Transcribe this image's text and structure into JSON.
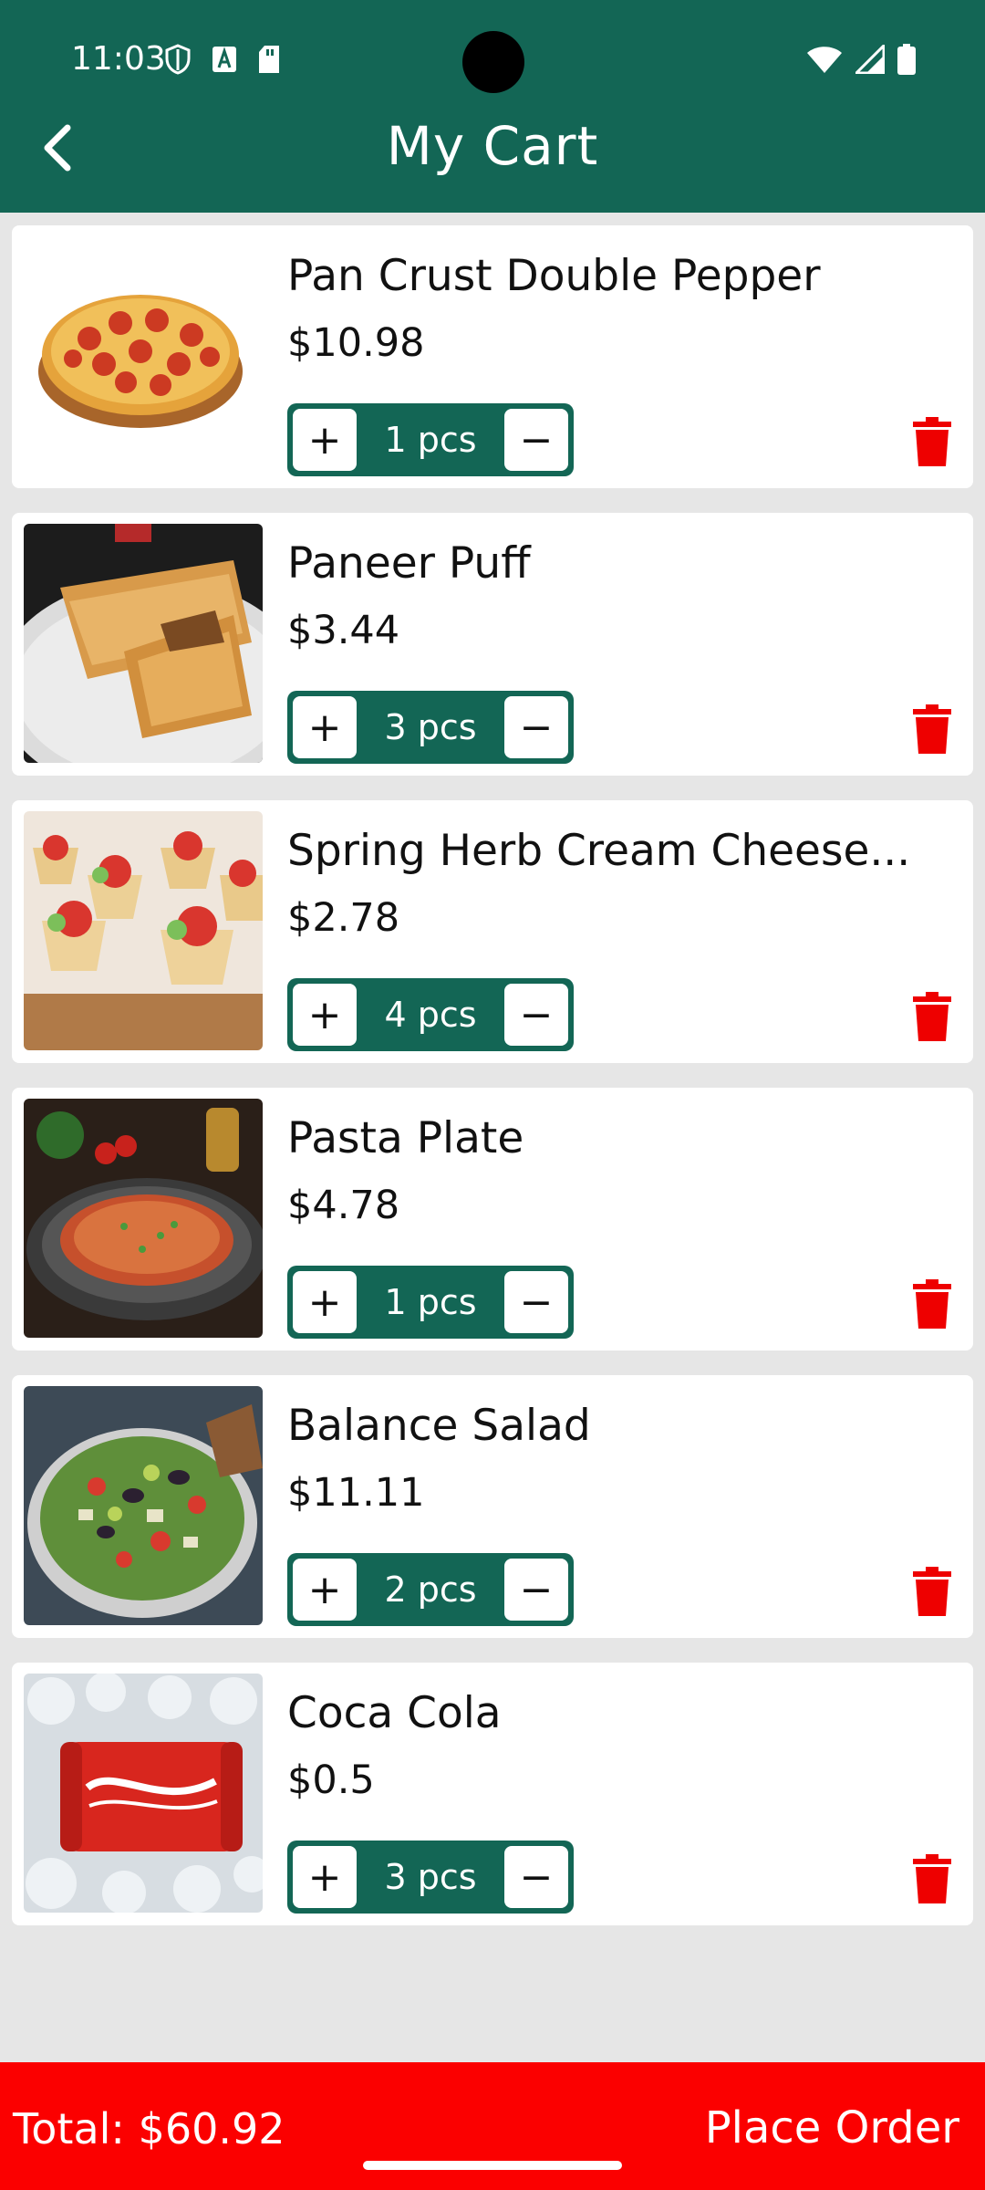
{
  "status_bar": {
    "time": "11:03"
  },
  "header": {
    "title": "My Cart"
  },
  "items": [
    {
      "name": "Pan Crust Double Pepper",
      "price": "$10.98",
      "qty": "1 pcs",
      "image": "pepperoni-pizza-image"
    },
    {
      "name": "Paneer Puff",
      "price": "$3.44",
      "qty": "3 pcs",
      "image": "paneer-puff-image"
    },
    {
      "name": "Spring Herb Cream Cheese...",
      "price": "$2.78",
      "qty": "4 pcs",
      "image": "herb-cheese-tarts-image"
    },
    {
      "name": "Pasta Plate",
      "price": "$4.78",
      "qty": "1 pcs",
      "image": "pasta-plate-image"
    },
    {
      "name": "Balance Salad",
      "price": "$11.11",
      "qty": "2 pcs",
      "image": "salad-bowl-image"
    },
    {
      "name": "Coca Cola",
      "price": "$0.5",
      "qty": "3 pcs",
      "image": "cola-can-image"
    }
  ],
  "stepper": {
    "plus": "+",
    "minus": "−"
  },
  "footer": {
    "total": "Total: $60.92",
    "place_order": "Place Order"
  },
  "colors": {
    "primary": "#136655",
    "accent": "#fb0000",
    "delete": "#ee0000",
    "background": "#e6e6e6"
  },
  "icons": [
    "back-arrow-icon",
    "trash-icon",
    "wifi-icon",
    "signal-icon",
    "battery-icon"
  ]
}
